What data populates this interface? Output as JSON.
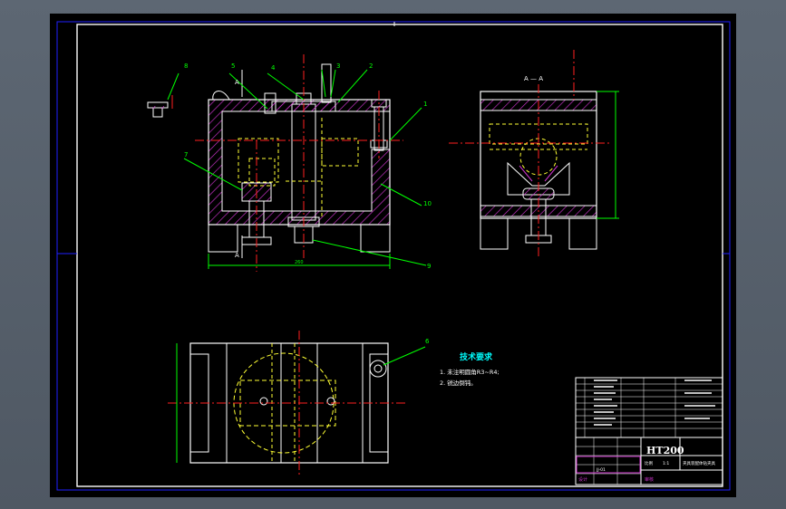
{
  "drawing": {
    "section_label": "A — A",
    "view_marker": "A",
    "tech_title": "技术要求",
    "tech_notes": [
      "1. 未注明圆角R3~R4;",
      "2. 锐边倒钝。"
    ],
    "dim_overall": "260",
    "part_balloons": [
      "1",
      "2",
      "3",
      "4",
      "5",
      "6",
      "7",
      "8",
      "9",
      "10"
    ]
  },
  "title_block": {
    "material": "HT200",
    "drawing_name": "夹具装配体钻夹具",
    "scale_label": "比例",
    "scale": "1:1",
    "designer_label": "设计",
    "checker_label": "审核",
    "drawing_no": "JJ-01"
  },
  "colors": {
    "sheet": "#000000",
    "outline": "#ffffff",
    "center": "#ff2020",
    "hidden": "#ffff33",
    "hatch": "#cc33cc",
    "dimension": "#00ff00",
    "frame": "#2020ff",
    "note": "#00ffff"
  }
}
